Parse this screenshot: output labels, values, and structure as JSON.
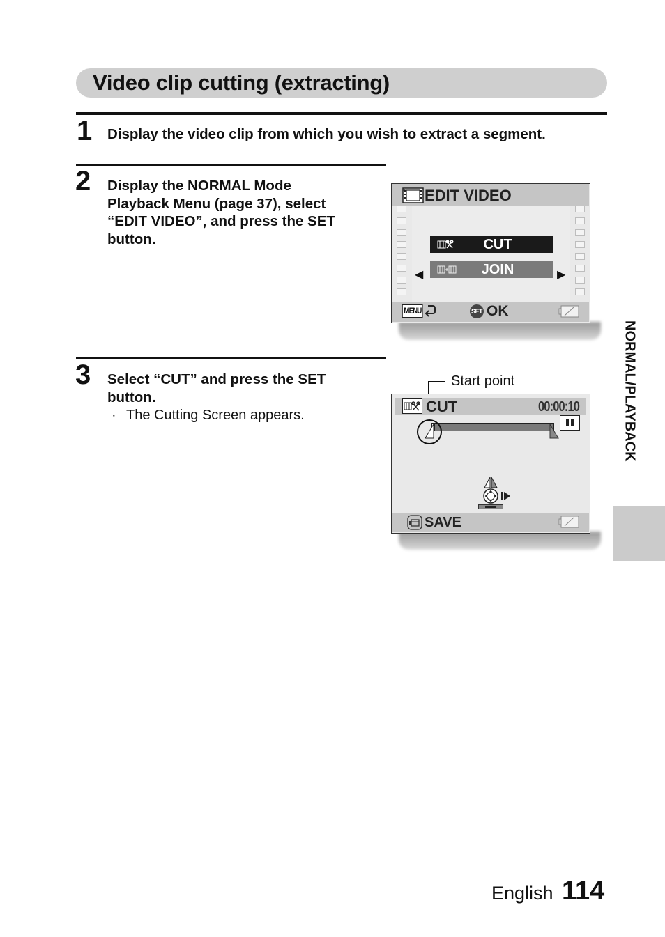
{
  "page": {
    "title": "Video clip cutting (extracting)",
    "section_tab": "NORMAL/PLAYBACK",
    "language": "English",
    "page_number": "114"
  },
  "steps": [
    {
      "number": "1",
      "text": "Display the video clip from which you wish to extract a segment."
    },
    {
      "number": "2",
      "lines": [
        "Display the NORMAL Mode",
        "Playback Menu (page 37), select",
        "“EDIT VIDEO”, and press the SET",
        "button."
      ]
    },
    {
      "number": "3",
      "lines": [
        "Select “CUT” and press the SET",
        "button."
      ],
      "bullet": "The Cutting Screen appears."
    }
  ],
  "screen_edit_video": {
    "header_icon": "film-edit-icon",
    "title": "EDIT VIDEO",
    "menu_items": [
      {
        "label": "CUT",
        "icon": "film-scissors-icon",
        "selected": true
      },
      {
        "label": "JOIN",
        "icon": "film-join-icon",
        "selected": false
      }
    ],
    "left_arrow": "◀",
    "right_arrow": "▶",
    "footer": {
      "menu_label": "MENU",
      "back_icon": "return-arrow-icon",
      "set_label": "SET",
      "ok_label": "OK",
      "battery_icon": "battery-icon"
    }
  },
  "screen_cut": {
    "callout": "Start point",
    "header_icon": "film-scissors-icon",
    "title": "CUT",
    "timecode": "00:00:10",
    "pause_icon": "pause-icon",
    "footer": {
      "save_icon": "save-icon",
      "save_label": "SAVE",
      "battery_icon": "battery-icon"
    }
  },
  "colors": {
    "title_bar": "#cfcfcf",
    "screen_bg": "#e9e9e9",
    "screen_bar": "#c5c5c5",
    "selected_item": "#1a1a1a",
    "unselected_item": "#7a7a7a",
    "side_tab": "#cbcbcb"
  }
}
